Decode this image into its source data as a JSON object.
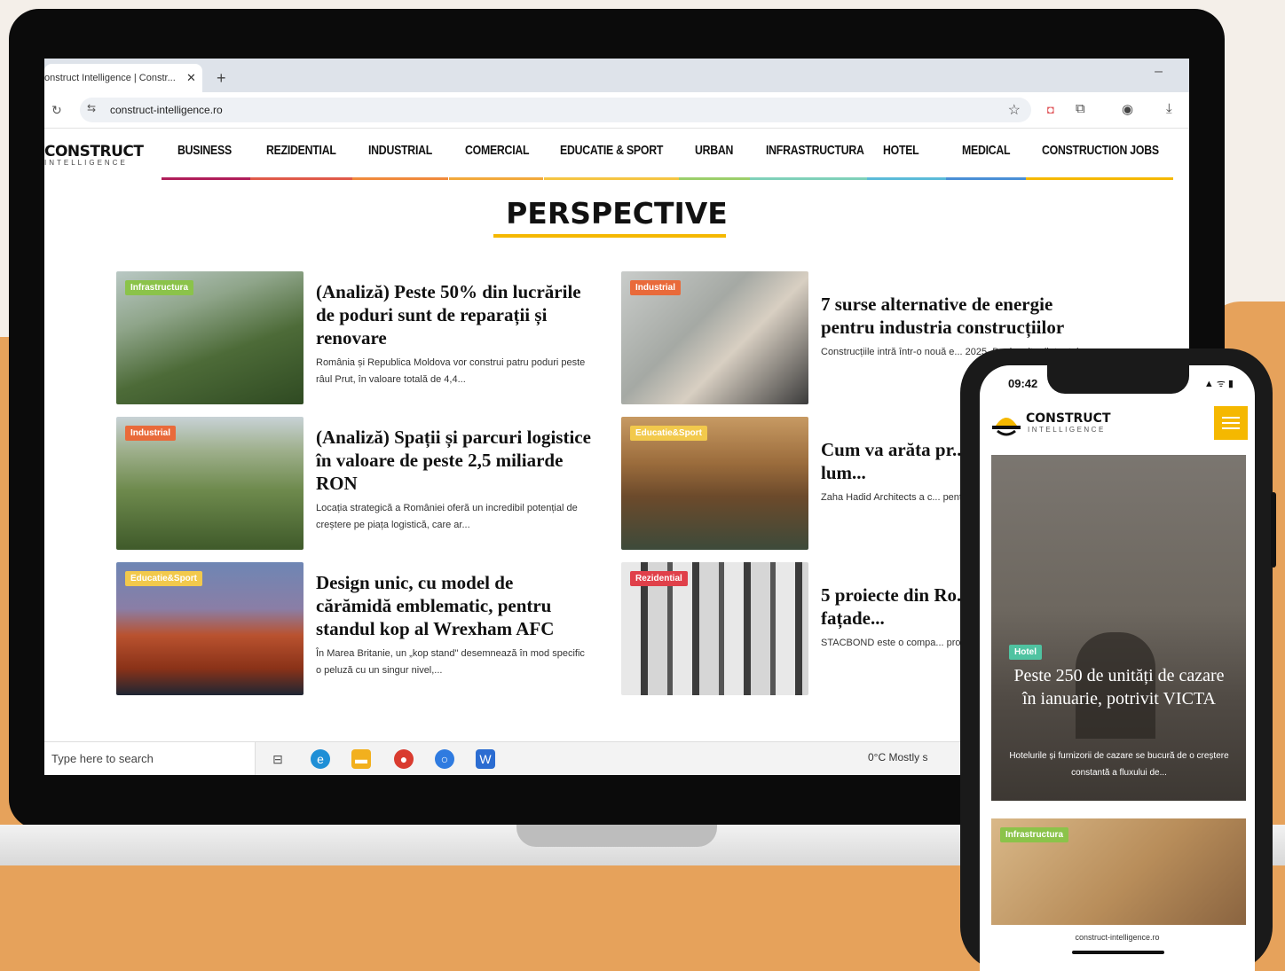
{
  "browser": {
    "tab_title": "onstruct Intelligence | Constr...",
    "tab_close": "✕",
    "new_tab": "+",
    "url": "construct-intelligence.ro"
  },
  "site": {
    "logo_main": "CONSTRUCT",
    "logo_sub": "INTELLIGENCE",
    "nav": [
      {
        "label": "BUSINESS",
        "color": "#b01e5a"
      },
      {
        "label": "REZIDENTIAL",
        "color": "#e05a4a"
      },
      {
        "label": "INDUSTRIAL",
        "color": "#f08a3c"
      },
      {
        "label": "COMERCIAL",
        "color": "#f2a93b"
      },
      {
        "label": "EDUCATIE & SPORT",
        "color": "#f5c542"
      },
      {
        "label": "URBAN",
        "color": "#9bcf6a"
      },
      {
        "label": "INFRASTRUCTURA",
        "color": "#7fd1b9"
      },
      {
        "label": "HOTEL",
        "color": "#5bbbd9"
      },
      {
        "label": "MEDICAL",
        "color": "#4a8fd6"
      },
      {
        "label": "CONSTRUCTION JOBS",
        "color": "#f5b800"
      }
    ],
    "section_title": "PERSPECTIVE"
  },
  "articles": [
    {
      "badge": "Infrastructura",
      "badge_color": "#8bc34a",
      "title": "(Analiză) Peste 50% din lucrările de poduri sunt de reparații și renovare",
      "excerpt": "România și Republica Moldova vor construi patru poduri peste râul Prut, în valoare totală de 4,4..."
    },
    {
      "badge": "Industrial",
      "badge_color": "#e96a3a",
      "title": "(Analiză) Spații și parcuri logistice în valoare de peste 2,5 miliarde RON",
      "excerpt": "Locația strategică a României oferă un incredibil potențial de creștere pe piața logistică, care ar..."
    },
    {
      "badge": "Educatie&Sport",
      "badge_color": "#f2c94c",
      "title": "Design unic, cu model de cărămidă emblematic, pentru standul kop al Wrexham AFC",
      "excerpt": "În Marea Britanie, un „kop stand\" desemnează în mod specific o peluză cu un singur nivel,..."
    },
    {
      "badge": "Industrial",
      "badge_color": "#e96a3a",
      "title": "7 surse alternative de energie pentru industria construcțiilor",
      "excerpt": "Construcțiile intră într-o nouă e... 2025. Deși multe dintre teh..."
    },
    {
      "badge": "Educatie&Sport",
      "badge_color": "#f2c94c",
      "title": "Cum va arăta pr... de lemn din lum...",
      "excerpt": "Zaha Hadid Architects a c... pentru Stadionul Eco Par..."
    },
    {
      "badge": "Rezidential",
      "badge_color": "#e0404a",
      "title": "5 proiecte din Ro... au folosit fațade...",
      "excerpt": "STACBOND este o compa... produce și comercializea..."
    }
  ],
  "taskbar": {
    "search_placeholder": "Type here to search",
    "weather": "0°C  Mostly s"
  },
  "phone": {
    "time": "09:42",
    "status": "▲ ᯤ ▮",
    "logo_main": "CONSTRUCT",
    "logo_sub": "INTELLIGENCE",
    "hero_badge": "Hotel",
    "hero_badge_color": "#4fc3a1",
    "hero_title": "Peste 250 de unități de cazare în ianuarie, potrivit VICTA",
    "hero_excerpt": "Hotelurile și furnizorii de cazare se bucură de o creștere constantă a fluxului de...",
    "card2_badge": "Infrastructura",
    "card2_badge_color": "#8bc34a",
    "url": "construct-intelligence.ro"
  }
}
